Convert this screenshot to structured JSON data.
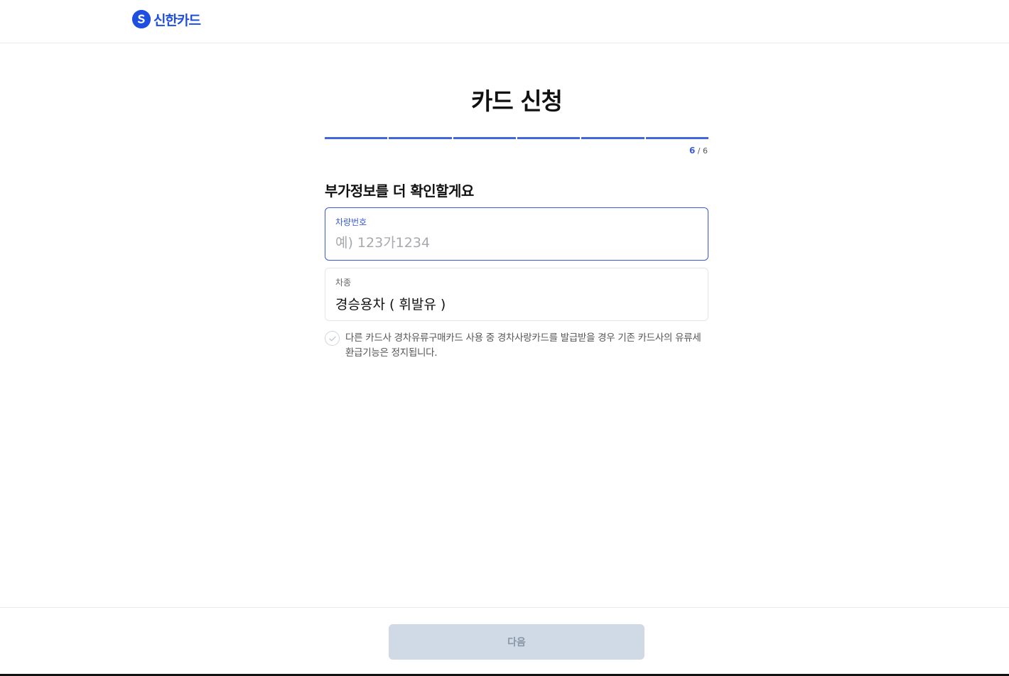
{
  "header": {
    "logo_text": "신한카드"
  },
  "page": {
    "title": "카드 신청",
    "progress": {
      "current": "6",
      "total": "/ 6",
      "steps_total": 6,
      "steps_done": 6
    },
    "section_title": "부가정보를 더 확인할게요"
  },
  "form": {
    "plate": {
      "label": "차량번호",
      "placeholder": "예) 123가1234",
      "value": ""
    },
    "car_type": {
      "label": "차종",
      "value": "경승용차 ( 휘발유 )"
    }
  },
  "notice": {
    "text": "다른 카드사 경차유류구매카드 사용 중 경차사랑카드를 발급받을 경우 기존 카드사의 유류세 환급기능은 정지됩니다."
  },
  "footer": {
    "next_label": "다음"
  },
  "colors": {
    "brand": "#1f4fe0",
    "accent": "#3a5bd9",
    "progress_track": "#dfe3ea",
    "button_disabled": "#d0dae6"
  }
}
